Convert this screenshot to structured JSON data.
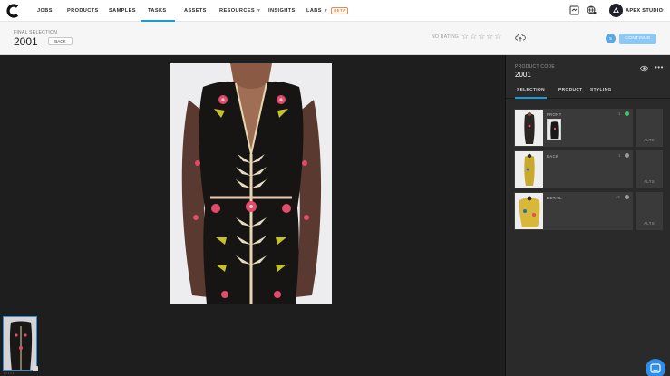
{
  "nav": {
    "items": [
      {
        "label": "JOBS",
        "caret": false,
        "active": false
      },
      {
        "label": "PRODUCTS",
        "caret": false,
        "active": false
      },
      {
        "label": "SAMPLES",
        "caret": false,
        "active": false
      },
      {
        "label": "TASKS",
        "caret": true,
        "active": true
      },
      {
        "label": "ASSETS",
        "caret": false,
        "active": false
      },
      {
        "label": "RESOURCES",
        "caret": true,
        "active": false
      },
      {
        "label": "INSIGHTS",
        "caret": false,
        "active": false
      },
      {
        "label": "LABS",
        "caret": true,
        "active": false
      }
    ],
    "beta_badge": "BETA",
    "studio_name": "APEX STUDIO",
    "accent_color": "#1c9ad6"
  },
  "subheader": {
    "label": "FINAL SELECTION",
    "code": "2001",
    "back_label": "BACK",
    "rating_label": "NO RATING",
    "rating": 0,
    "stars_max": 5,
    "stars_text": "☆☆☆☆☆",
    "step": "5",
    "continue_label": "CONTINUE"
  },
  "panel": {
    "label": "PRODUCT CODE",
    "code": "2001",
    "tabs": [
      "SELECTION",
      "PRODUCT",
      "STYLING"
    ],
    "active_tab": "SELECTION",
    "shots": [
      {
        "name": "FRONT",
        "count": "1",
        "status": "approved",
        "status_color": "#43c46a",
        "alts_label": "ALTS"
      },
      {
        "name": "BACK",
        "count": "1",
        "status": "info",
        "status_color": "#9a9a9a",
        "alts_label": "ALTS"
      },
      {
        "name": "DETAIL",
        "count": "46",
        "status": "info",
        "status_color": "#9a9a9a",
        "alts_label": "ALTS"
      }
    ]
  },
  "viewer": {
    "thumb_dots": "•••••"
  },
  "icons": [
    "c-logo-icon",
    "message-icon",
    "globe-icon",
    "avatar-icon",
    "star-icon",
    "cloud-upload-icon",
    "eye-icon",
    "more-icon",
    "check-icon",
    "info-icon",
    "chat-icon"
  ]
}
